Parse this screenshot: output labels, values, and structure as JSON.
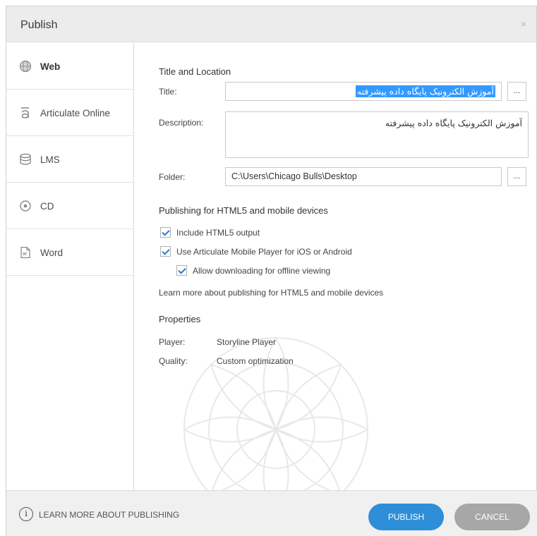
{
  "window": {
    "title": "Publish",
    "close_glyph": "×"
  },
  "sidebar": {
    "items": [
      {
        "label": "Web",
        "icon": "globe-icon",
        "active": true
      },
      {
        "label": "Articulate Online",
        "icon": "articulate-icon",
        "active": false
      },
      {
        "label": "LMS",
        "icon": "database-icon",
        "active": false
      },
      {
        "label": "CD",
        "icon": "disc-icon",
        "active": false
      },
      {
        "label": "Word",
        "icon": "word-document-icon",
        "active": false
      }
    ]
  },
  "title_location": {
    "heading": "Title and Location",
    "title_label": "Title:",
    "title_value": "آموزش الکترونیک پایگاه داده پیشرفته",
    "description_label": "Description:",
    "description_value": "آموزش الکترونیک پایگاه داده پیشرفته",
    "folder_label": "Folder:",
    "folder_value": "C:\\Users\\Chicago Bulls\\Desktop",
    "browse_label": "..."
  },
  "html5": {
    "heading": "Publishing for HTML5 and mobile devices",
    "include_html5": "Include HTML5 output",
    "use_mobile_player": "Use Articulate Mobile Player for iOS or Android",
    "allow_offline": "Allow downloading for offline viewing",
    "learn_more": "Learn more about publishing for HTML5 and mobile devices"
  },
  "properties": {
    "heading": "Properties",
    "player_label": "Player:",
    "player_value": "Storyline Player",
    "quality_label": "Quality:",
    "quality_value": "Custom optimization"
  },
  "footer": {
    "info_glyph": "i",
    "learn_more": "LEARN MORE ABOUT PUBLISHING",
    "publish": "PUBLISH",
    "cancel": "CANCEL"
  },
  "colors": {
    "accent": "#2f8ed8",
    "cancel": "#a7a7a7",
    "selection": "#3399ff",
    "check": "#2a7bd6"
  }
}
